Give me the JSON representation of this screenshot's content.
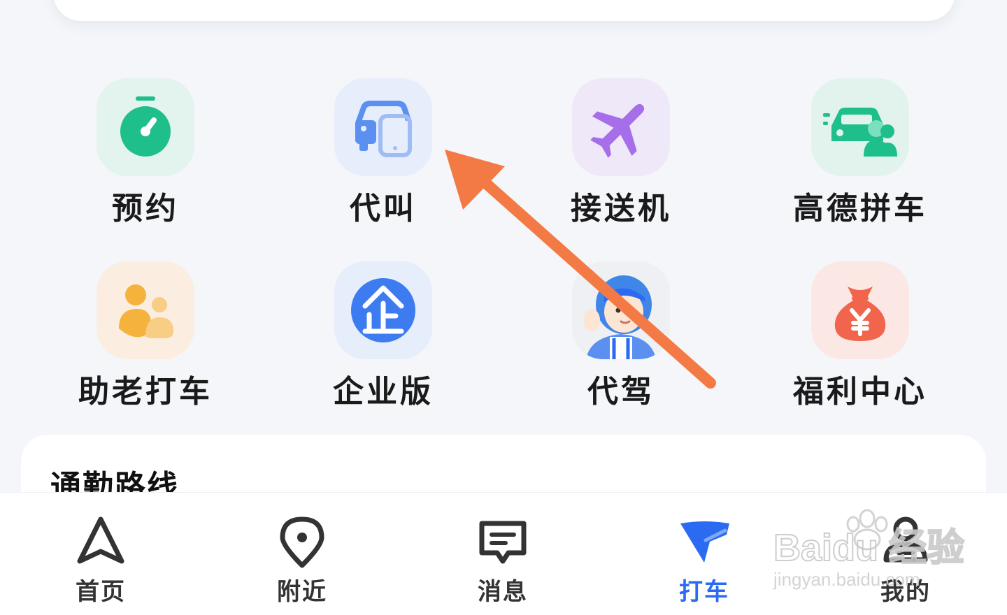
{
  "services": [
    {
      "label": "预约",
      "icon": "stopwatch-icon"
    },
    {
      "label": "代叫",
      "icon": "car-phone-icon"
    },
    {
      "label": "接送机",
      "icon": "airplane-icon"
    },
    {
      "label": "高德拼车",
      "icon": "carpool-icon"
    },
    {
      "label": "助老打车",
      "icon": "elderly-icon"
    },
    {
      "label": "企业版",
      "icon": "enterprise-icon"
    },
    {
      "label": "代驾",
      "icon": "driver-avatar-icon"
    },
    {
      "label": "福利中心",
      "icon": "money-bag-icon"
    }
  ],
  "route_section": {
    "title": "通勤路线"
  },
  "tabbar": {
    "items": [
      {
        "label": "首页",
        "icon": "navigation-arrow-icon"
      },
      {
        "label": "附近",
        "icon": "location-pin-icon"
      },
      {
        "label": "消息",
        "icon": "message-icon"
      },
      {
        "label": "打车",
        "icon": "taxi-icon"
      },
      {
        "label": "我的",
        "icon": "user-icon"
      }
    ],
    "active_index": 3
  },
  "watermark": {
    "text": "Baidu 经验",
    "url_text": "jingyan.baidu.com"
  },
  "colors": {
    "accent": "#2a6bf2",
    "annotation_arrow": "#f47a45",
    "green": "#1fbf8c"
  }
}
